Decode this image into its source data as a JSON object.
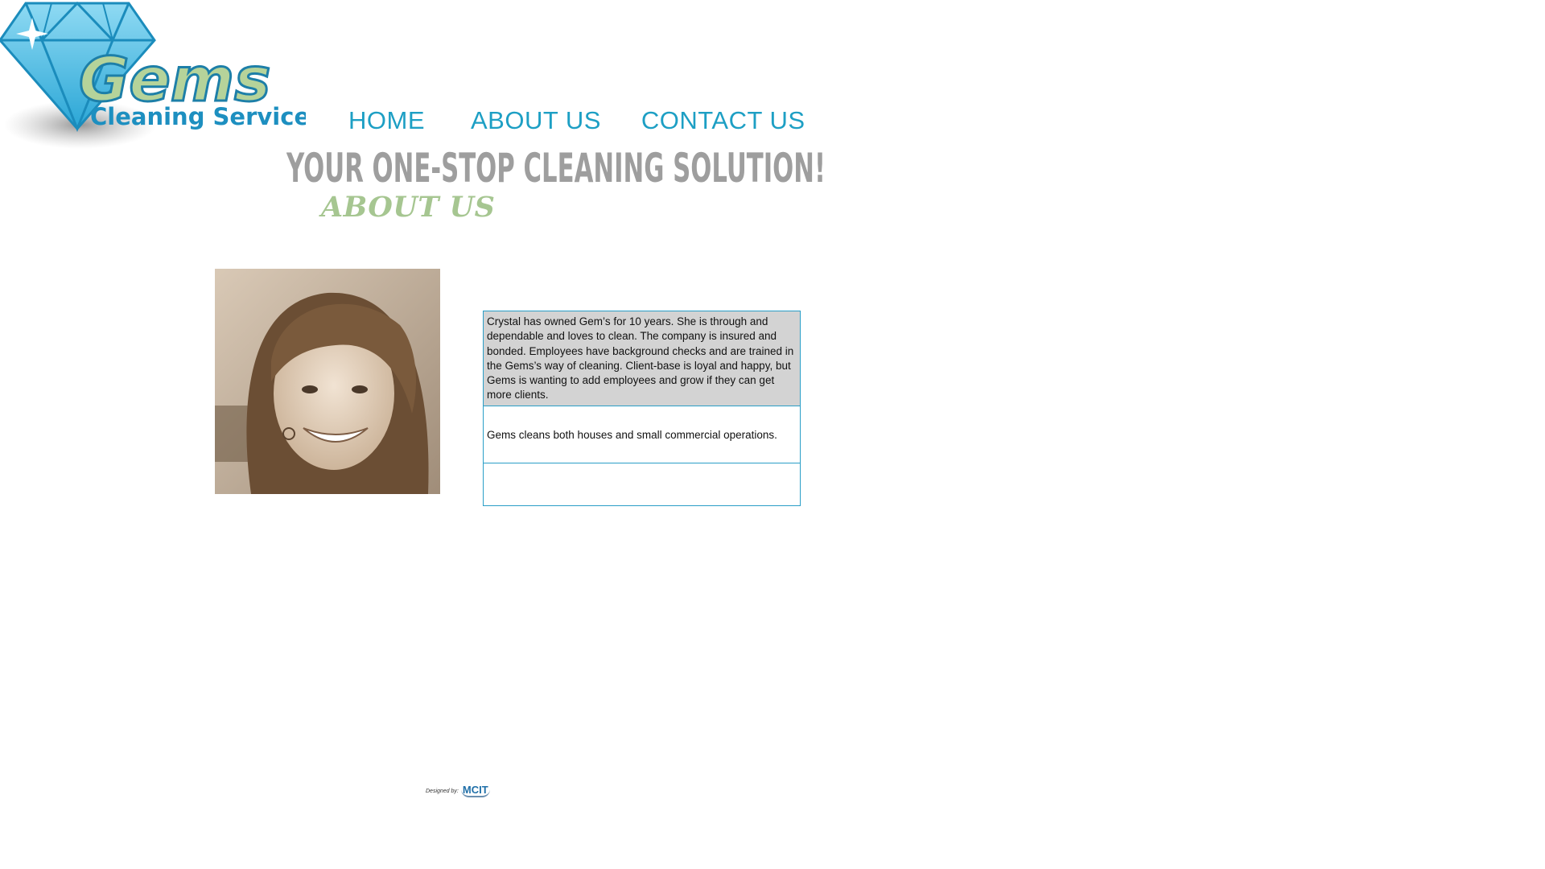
{
  "brand": {
    "logo_word": "Gems",
    "logo_subtitle": "Cleaning Service",
    "colors": {
      "diamond": "#3fb7e0",
      "logo_text": "#b5d39a",
      "subtitle_text": "#1d8fc0"
    }
  },
  "nav": {
    "items": [
      {
        "label": "HOME"
      },
      {
        "label": "ABOUT US"
      },
      {
        "label": "CONTACT US"
      }
    ],
    "color": "#1d9fc4"
  },
  "tagline": "YOUR ONE-STOP CLEANING SOLUTION!",
  "section_title": "ABOUT US",
  "photo": {
    "description_icon": "portrait-photo"
  },
  "info": {
    "paragraph_1": "Crystal has owned Gem’s for 10 years. She is through and dependable and loves to clean. The company is insured and bonded. Employees have background checks and are trained in the Gems’s way of cleaning. Client-base is loyal and happy, but Gems is wanting to add employees and grow if they can get more clients.",
    "paragraph_2": "Gems cleans both houses and small commercial operations.",
    "paragraph_3": ""
  },
  "footer": {
    "credit_label": "Designed by:",
    "credit_logo": "MCIT"
  }
}
